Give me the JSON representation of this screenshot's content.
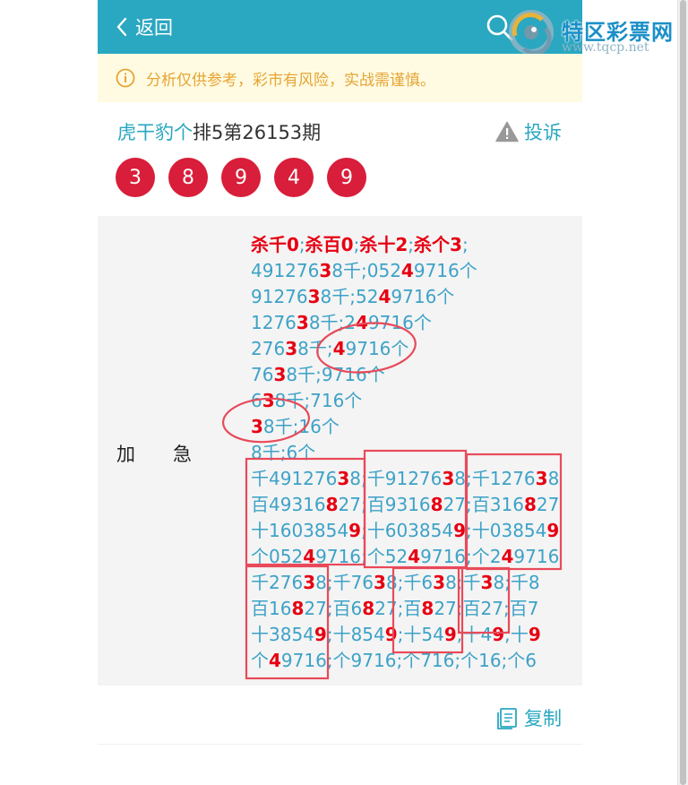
{
  "header": {
    "back_label": "返回"
  },
  "logo": {
    "name": "特区彩票网",
    "url": "www.tqcp.net"
  },
  "notice": {
    "text": "分析仅供参考，彩市有风险，实战需谨慎。"
  },
  "meta": {
    "author": "虎干豹个",
    "issue": "排5第26153期",
    "complain_label": "投诉"
  },
  "balls": [
    "3",
    "8",
    "9",
    "4",
    "9"
  ],
  "analysis": {
    "side_label_1": "加",
    "side_label_2": "急",
    "lines": [
      [
        {
          "t": "杀千0",
          "c": "r"
        },
        {
          "t": ";",
          "c": "n"
        },
        {
          "t": "杀百0",
          "c": "r"
        },
        {
          "t": ";",
          "c": "n"
        },
        {
          "t": "杀十2",
          "c": "r"
        },
        {
          "t": ";",
          "c": "n"
        },
        {
          "t": "杀个3",
          "c": "r"
        },
        {
          "t": ";",
          "c": "n"
        }
      ],
      [
        {
          "t": "491276",
          "c": "n"
        },
        {
          "t": "3",
          "c": "r"
        },
        {
          "t": "8千;052",
          "c": "n"
        },
        {
          "t": "4",
          "c": "r"
        },
        {
          "t": "9716个",
          "c": "n"
        }
      ],
      [
        {
          "t": "91276",
          "c": "n"
        },
        {
          "t": "3",
          "c": "r"
        },
        {
          "t": "8千;52",
          "c": "n"
        },
        {
          "t": "4",
          "c": "r"
        },
        {
          "t": "9716个",
          "c": "n"
        }
      ],
      [
        {
          "t": "1276",
          "c": "n"
        },
        {
          "t": "3",
          "c": "r"
        },
        {
          "t": "8千;2",
          "c": "n"
        },
        {
          "t": "4",
          "c": "r"
        },
        {
          "t": "9716个",
          "c": "n"
        }
      ],
      [
        {
          "t": "276",
          "c": "n"
        },
        {
          "t": "3",
          "c": "r"
        },
        {
          "t": "8千;",
          "c": "n"
        },
        {
          "t": "4",
          "c": "r"
        },
        {
          "t": "9716个",
          "c": "n"
        }
      ],
      [
        {
          "t": "76",
          "c": "n"
        },
        {
          "t": "3",
          "c": "r"
        },
        {
          "t": "8千;9716个",
          "c": "n"
        }
      ],
      [
        {
          "t": "6",
          "c": "n"
        },
        {
          "t": "3",
          "c": "r"
        },
        {
          "t": "8千;716个",
          "c": "n"
        }
      ],
      [
        {
          "t": "3",
          "c": "r"
        },
        {
          "t": "8千;16个",
          "c": "n"
        }
      ],
      [
        {
          "t": "8千;6个",
          "c": "n"
        }
      ],
      [
        {
          "t": "千491276",
          "c": "n"
        },
        {
          "t": "3",
          "c": "r"
        },
        {
          "t": "8;千91276",
          "c": "n"
        },
        {
          "t": "3",
          "c": "r"
        },
        {
          "t": "8;千1276",
          "c": "n"
        },
        {
          "t": "3",
          "c": "r"
        },
        {
          "t": "8",
          "c": "n"
        }
      ],
      [
        {
          "t": "百49316",
          "c": "n"
        },
        {
          "t": "8",
          "c": "r"
        },
        {
          "t": "27;百9316",
          "c": "n"
        },
        {
          "t": "8",
          "c": "r"
        },
        {
          "t": "27;百316",
          "c": "n"
        },
        {
          "t": "8",
          "c": "r"
        },
        {
          "t": "27",
          "c": "n"
        }
      ],
      [
        {
          "t": "十1603854",
          "c": "n"
        },
        {
          "t": "9",
          "c": "r"
        },
        {
          "t": ";十603854",
          "c": "n"
        },
        {
          "t": "9",
          "c": "r"
        },
        {
          "t": ";十03854",
          "c": "n"
        },
        {
          "t": "9",
          "c": "r"
        }
      ],
      [
        {
          "t": "个052",
          "c": "n"
        },
        {
          "t": "4",
          "c": "r"
        },
        {
          "t": "9716;个52",
          "c": "n"
        },
        {
          "t": "4",
          "c": "r"
        },
        {
          "t": "9716;个2",
          "c": "n"
        },
        {
          "t": "4",
          "c": "r"
        },
        {
          "t": "9716",
          "c": "n"
        }
      ],
      [
        {
          "t": "千276",
          "c": "n"
        },
        {
          "t": "3",
          "c": "r"
        },
        {
          "t": "8;千76",
          "c": "n"
        },
        {
          "t": "3",
          "c": "r"
        },
        {
          "t": "8;千6",
          "c": "n"
        },
        {
          "t": "3",
          "c": "r"
        },
        {
          "t": "8;千",
          "c": "n"
        },
        {
          "t": "3",
          "c": "r"
        },
        {
          "t": "8;千8",
          "c": "n"
        }
      ],
      [
        {
          "t": "百16",
          "c": "n"
        },
        {
          "t": "8",
          "c": "r"
        },
        {
          "t": "27;百6",
          "c": "n"
        },
        {
          "t": "8",
          "c": "r"
        },
        {
          "t": "27;百",
          "c": "n"
        },
        {
          "t": "8",
          "c": "r"
        },
        {
          "t": "27;百27;百7",
          "c": "n"
        }
      ],
      [
        {
          "t": "十3854",
          "c": "n"
        },
        {
          "t": "9",
          "c": "r"
        },
        {
          "t": ";十854",
          "c": "n"
        },
        {
          "t": "9",
          "c": "r"
        },
        {
          "t": ";十54",
          "c": "n"
        },
        {
          "t": "9",
          "c": "r"
        },
        {
          "t": ";十4",
          "c": "n"
        },
        {
          "t": "9",
          "c": "r"
        },
        {
          "t": ";十",
          "c": "n"
        },
        {
          "t": "9",
          "c": "r"
        }
      ],
      [
        {
          "t": "个",
          "c": "n"
        },
        {
          "t": "4",
          "c": "r"
        },
        {
          "t": "9716;个9716;个716;个16;个6",
          "c": "n"
        }
      ]
    ]
  },
  "copy_label": "复制",
  "colors": {
    "brand": "#2aa7c1",
    "ball": "#d81e3a",
    "highlight": "#e60012",
    "notice_bg": "#fefbe2",
    "notice_text": "#e7a434",
    "annotation": "#e84a5a"
  }
}
